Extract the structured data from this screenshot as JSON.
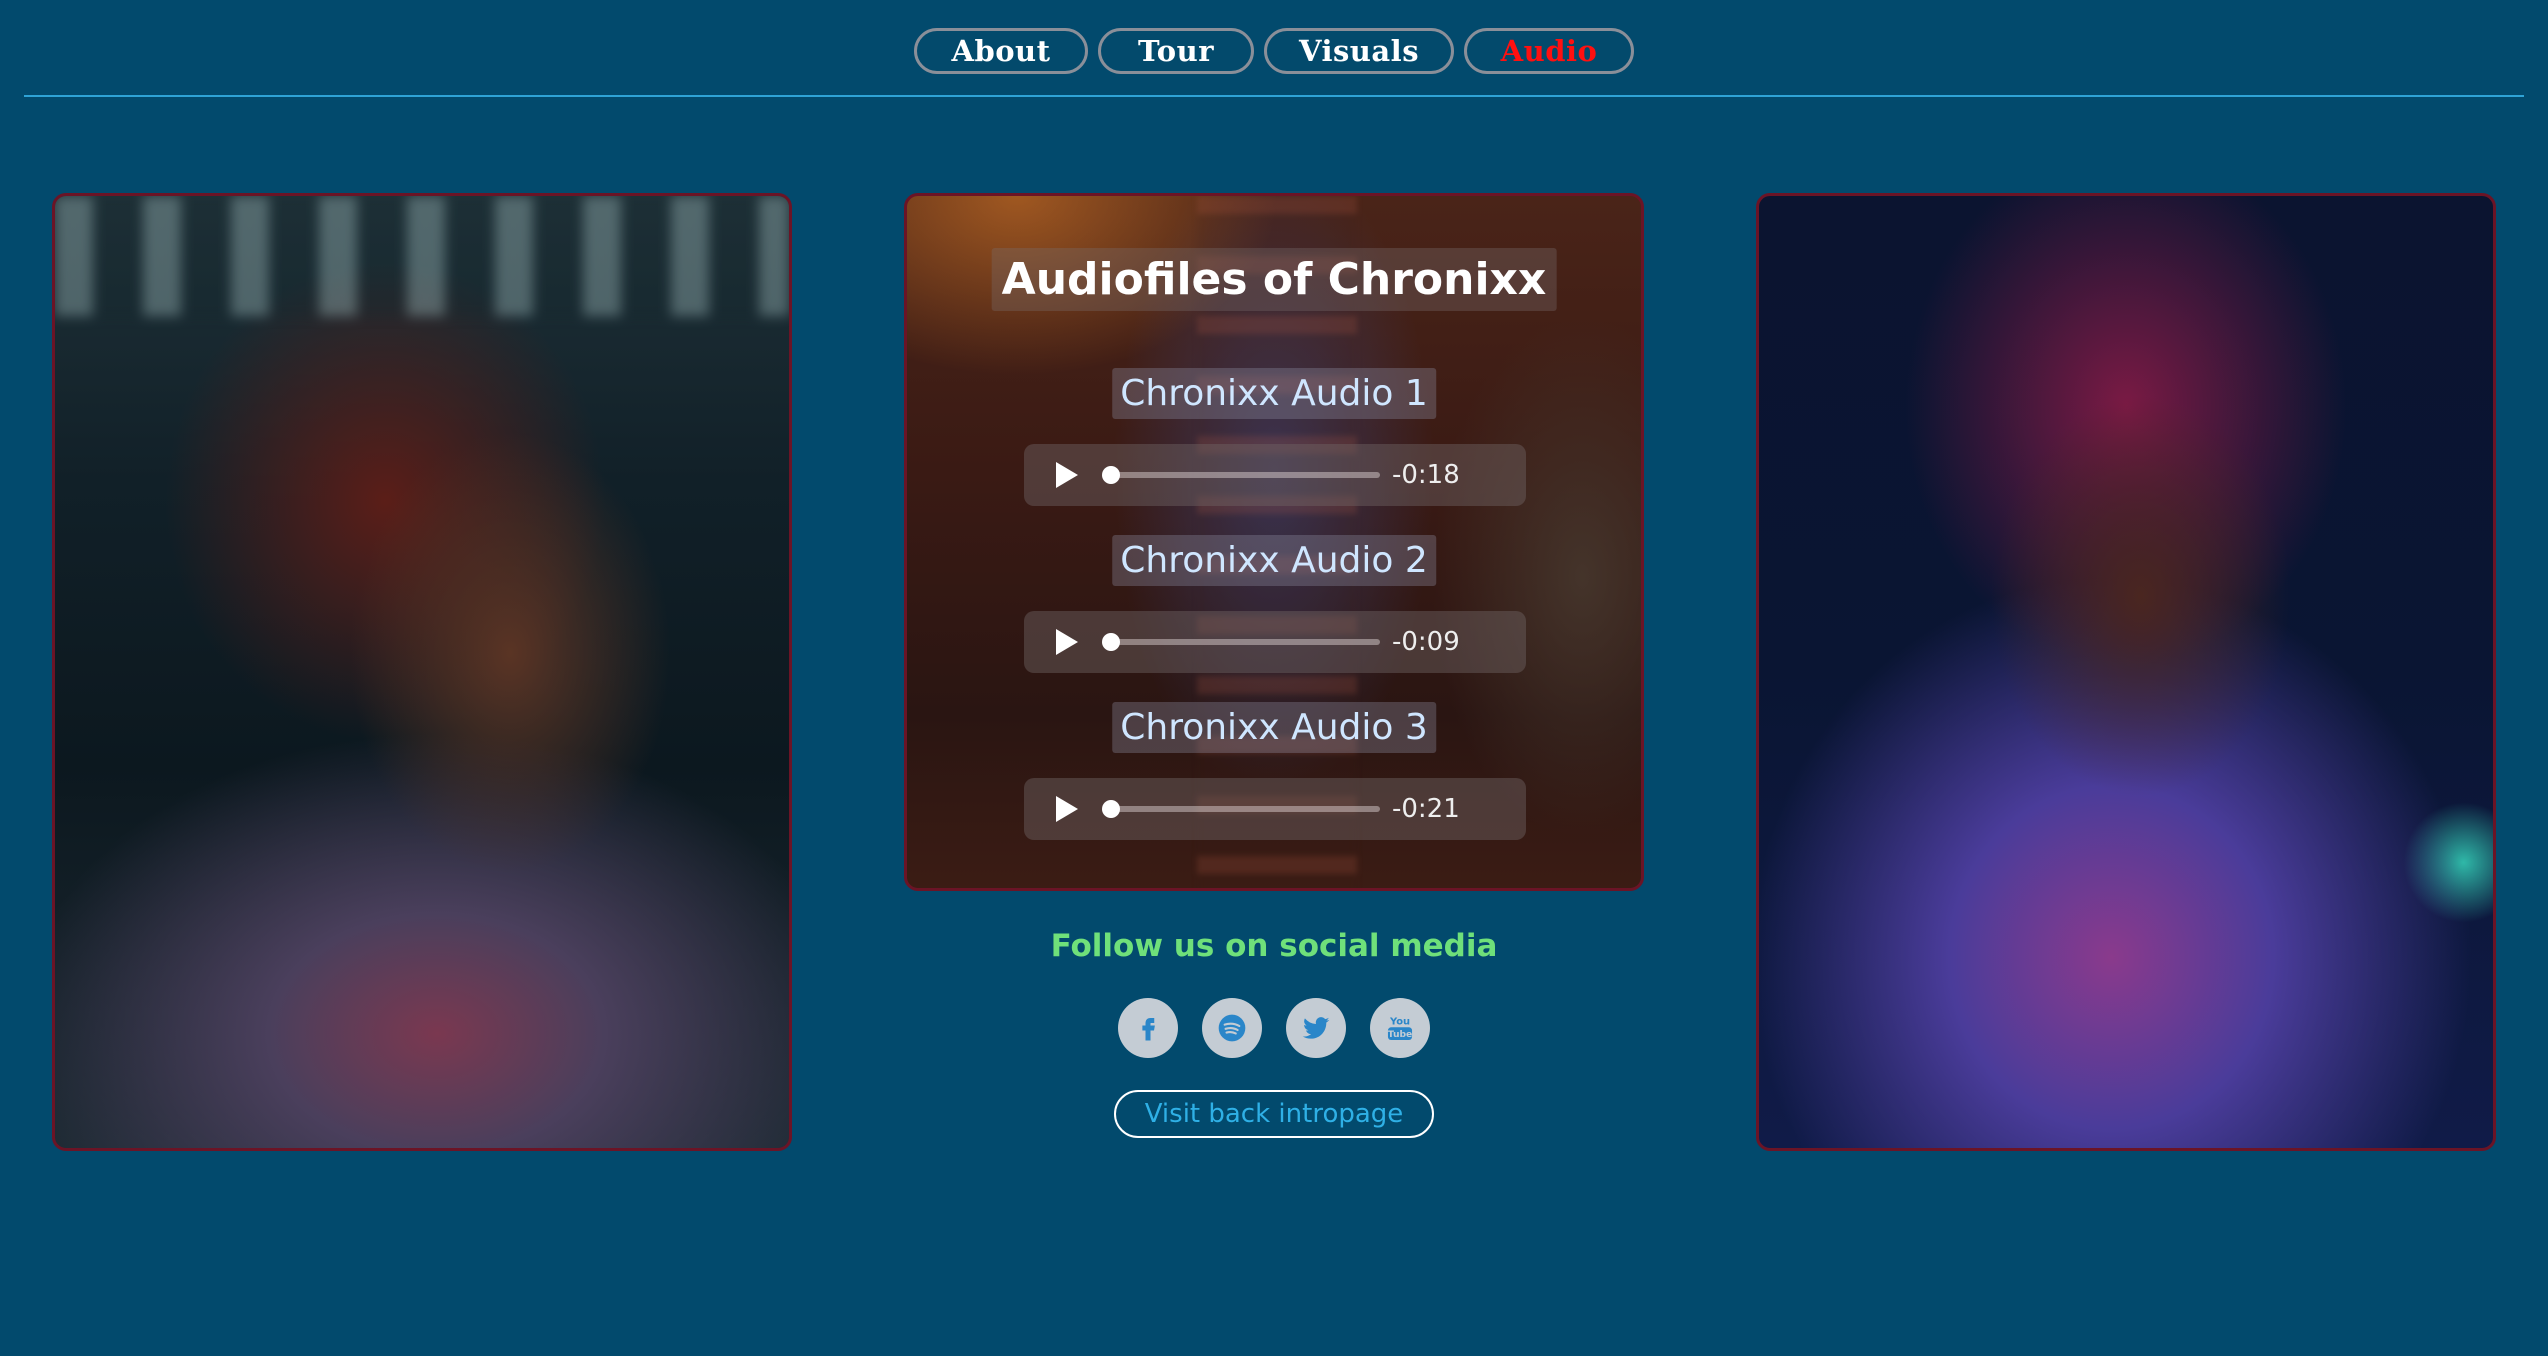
{
  "nav": {
    "items": [
      {
        "label": "About",
        "active": false
      },
      {
        "label": "Tour",
        "active": false
      },
      {
        "label": "Visuals",
        "active": false
      },
      {
        "label": "Audio",
        "active": true
      }
    ]
  },
  "audio_card": {
    "title": "Audiofiles of Chronixx",
    "tracks": [
      {
        "label": "Chronixx Audio 1",
        "time": "-0:18",
        "progress": 0
      },
      {
        "label": "Chronixx Audio 2",
        "time": "-0:09",
        "progress": 0
      },
      {
        "label": "Chronixx Audio 3",
        "time": "-0:21",
        "progress": 0
      }
    ]
  },
  "social": {
    "heading": "Follow us on social media",
    "icons": [
      "facebook-icon",
      "spotify-icon",
      "twitter-icon",
      "youtube-icon"
    ],
    "youtube_text": "You Tube"
  },
  "visit_button": {
    "label": "Visit back intropage"
  },
  "colors": {
    "background": "#024a6d",
    "active_nav": "#ff1010",
    "social_heading": "#6fe07a",
    "link": "#2fb0e6",
    "panel_border": "#6b1426"
  }
}
